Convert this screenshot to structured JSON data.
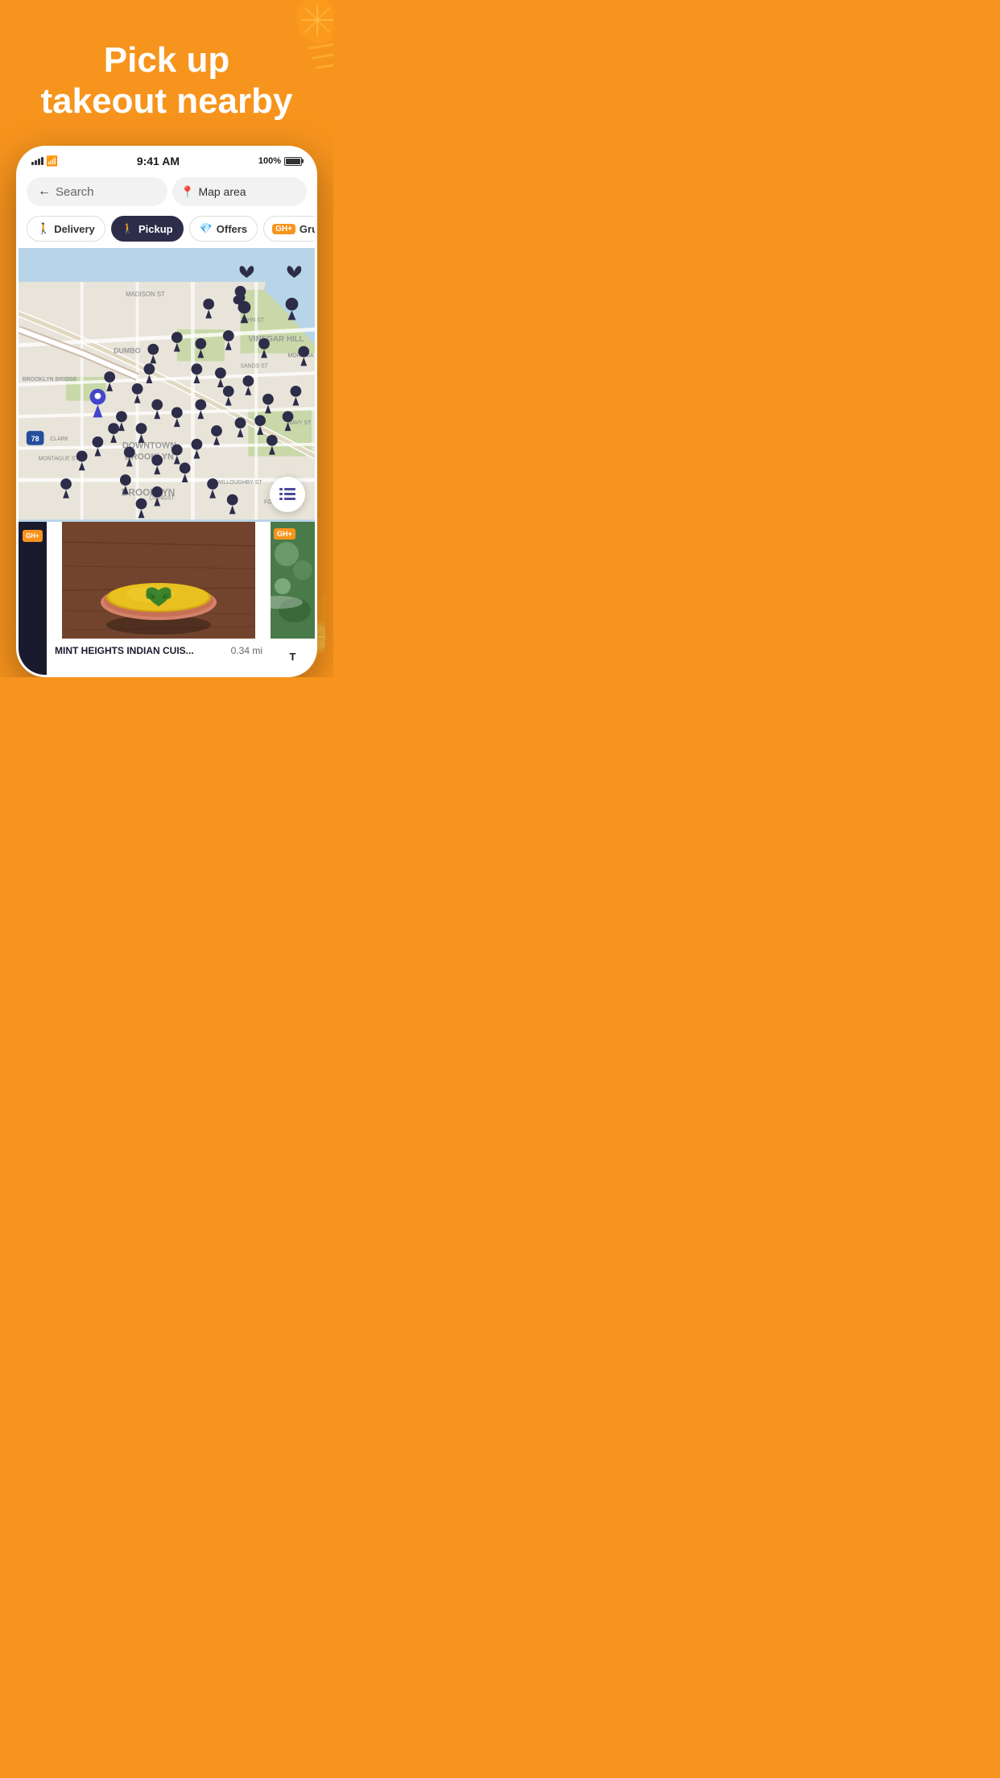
{
  "header": {
    "title_line1": "Pick up",
    "title_line2": "takeout nearby",
    "background_color": "#F7941D"
  },
  "status_bar": {
    "time": "9:41 AM",
    "battery": "100%",
    "signal": "full"
  },
  "search": {
    "placeholder": "Search",
    "back_label": "←",
    "location_label": "Map area"
  },
  "filters": [
    {
      "id": "delivery",
      "label": "Delivery",
      "active": false,
      "icon": "🚶"
    },
    {
      "id": "pickup",
      "label": "Pickup",
      "active": true,
      "icon": "🚶"
    },
    {
      "id": "offers",
      "label": "Offers",
      "active": false,
      "icon": "💎"
    },
    {
      "id": "grubhub-plus",
      "label": "Gru",
      "active": false,
      "badge": "GH+"
    }
  ],
  "map": {
    "area_name": "Downtown Brooklyn",
    "neighborhood_labels": [
      "VINEGAR HILL",
      "DOWNTOWN\nBROOKLYN",
      "BROOKLYN",
      "DUMBO"
    ],
    "street_labels": [
      "MADISON ST",
      "JOHN ST",
      "SANDS ST",
      "CLARK",
      "MONTAGUE ST",
      "LIVINGST",
      "WILLOUGHBY ST",
      "FORT GREENE",
      "NAVY ST",
      "MORRISA"
    ],
    "list_button_icon": "≡"
  },
  "restaurant_cards": [
    {
      "id": "mint-heights",
      "name": "MINT HEIGHTS INDIAN CUIS...",
      "distance": "0.34 mi",
      "has_gh_plus": true,
      "image_description": "yellow curry soup bowl"
    },
    {
      "id": "card-right",
      "name": "T",
      "has_gh_plus": true,
      "image_description": "green vegetables"
    }
  ],
  "colors": {
    "orange": "#F7941D",
    "dark_navy": "#2D2D4A",
    "map_water": "#B8D4E8",
    "map_land": "#E8E4D9",
    "map_green": "#C8D8A8",
    "map_road": "#FFFFFF",
    "pin_color": "#2D2D4A",
    "active_pin": "#4040CC"
  }
}
